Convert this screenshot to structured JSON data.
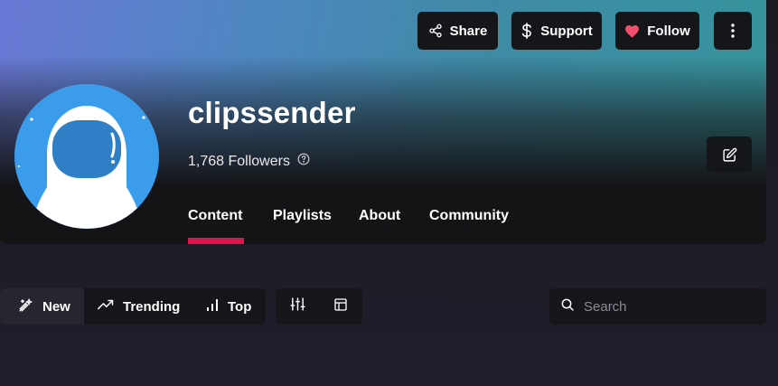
{
  "header": {
    "channel_name": "clipssender",
    "followers": "1,768 Followers",
    "actions": {
      "share_label": "Share",
      "support_label": "Support",
      "follow_label": "Follow"
    },
    "icons": {
      "share": "share-icon",
      "support": "dollar-icon",
      "follow": "heart-icon",
      "more": "more-vertical-icon",
      "edit": "edit-icon",
      "help": "help-circle-icon"
    }
  },
  "tabs": [
    {
      "label": "Content",
      "active": true
    },
    {
      "label": "Playlists",
      "active": false
    },
    {
      "label": "About",
      "active": false
    },
    {
      "label": "Community",
      "active": false
    }
  ],
  "sort": {
    "options": [
      {
        "label": "New",
        "icon": "sparkle-icon",
        "active": true
      },
      {
        "label": "Trending",
        "icon": "trending-up-icon",
        "active": false
      },
      {
        "label": "Top",
        "icon": "bar-chart-icon",
        "active": false
      }
    ]
  },
  "view_controls": [
    {
      "icon": "sliders-icon"
    },
    {
      "icon": "layout-icon"
    }
  ],
  "search": {
    "placeholder": "Search",
    "value": ""
  },
  "colors": {
    "accent": "#e0134f",
    "heart": "#f0506e",
    "avatar_bg": "#3b9cec",
    "banner_start": "#6a78d6",
    "banner_end": "#35949c"
  }
}
